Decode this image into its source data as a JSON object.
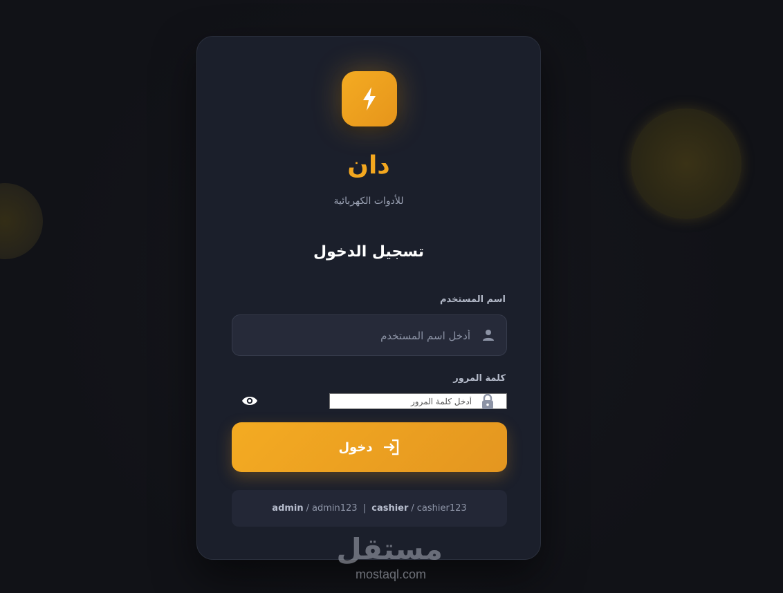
{
  "app": {
    "brand_name": "دان",
    "tagline": "للأدوات الكهربائية",
    "brand_color": "#f3a71f"
  },
  "form": {
    "heading": "تسجيل الدخول",
    "username": {
      "label": "اسم المستخدم",
      "placeholder": "أدخل اسم المستخدم",
      "value": "",
      "icon": "user-icon"
    },
    "password": {
      "label": "كلمة المرور",
      "placeholder": "أدخل كلمة المرور",
      "value": "",
      "icon": "lock-icon",
      "toggle_icon": "eye-icon"
    },
    "submit": {
      "label": "دخول",
      "icon": "login-icon"
    }
  },
  "demo_credentials": {
    "admin_user": "admin",
    "admin_pass": "admin123",
    "cashier_user": "cashier",
    "cashier_pass": "cashier123"
  },
  "watermark": {
    "arabic": "مستقل",
    "latin": "mostaql.com"
  }
}
